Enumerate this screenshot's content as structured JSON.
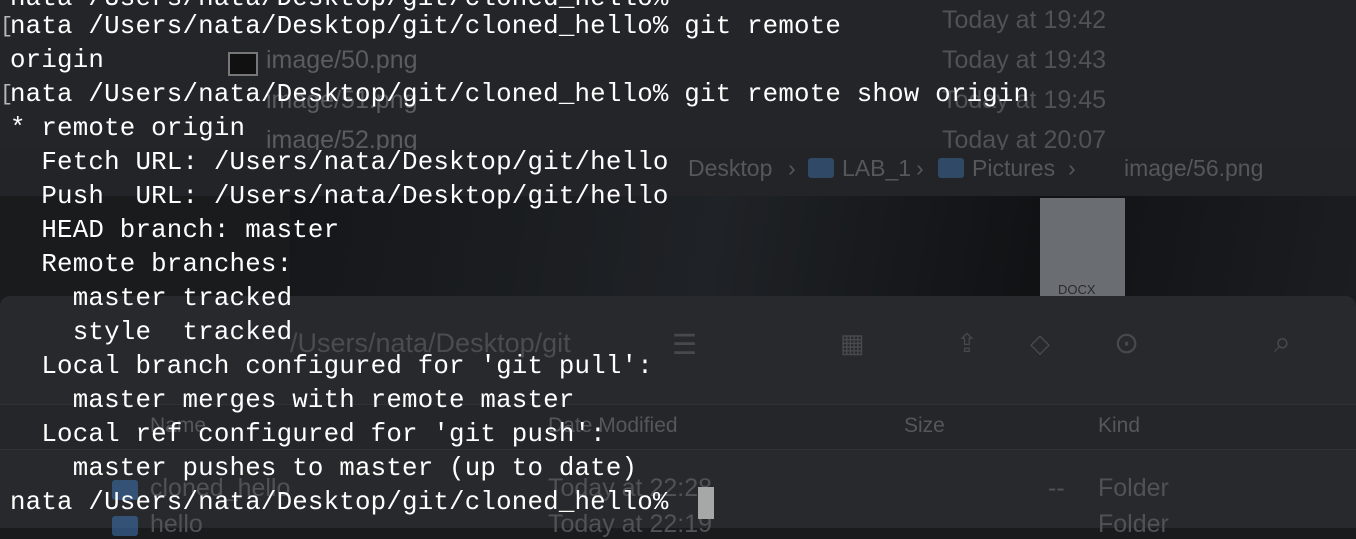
{
  "background_finder": {
    "file_rows": [
      {
        "name": "",
        "modified": "Today at 19:42"
      },
      {
        "name": "image/50.png",
        "modified": "Today at 19:43"
      },
      {
        "name": "image/51.png",
        "modified": "Today at 19:45"
      },
      {
        "name": "image/52.png",
        "modified": "Today at 20:07"
      }
    ],
    "path_bar": [
      "Desktop",
      "LAB_1",
      "Pictures",
      "image/56.png"
    ],
    "doc_thumb_label": "DOCX",
    "window2_title": "/Users/nata/Desktop/git",
    "columns": {
      "name": "Name",
      "modified": "Date Modified",
      "size": "Size",
      "kind": "Kind"
    },
    "rows": [
      {
        "name": "cloned_hello",
        "modified": "Today at 22:28",
        "size": "--",
        "kind": "Folder"
      },
      {
        "name": "hello",
        "modified": "Today at 22:19",
        "size": "--",
        "kind": "Folder"
      }
    ]
  },
  "terminal": {
    "top_partial_line": "nata /Users/nata/Desktop/git/cloned_hello%",
    "lines": [
      "nata /Users/nata/Desktop/git/cloned_hello% git remote",
      "origin",
      "nata /Users/nata/Desktop/git/cloned_hello% git remote show origin",
      "* remote origin",
      "  Fetch URL: /Users/nata/Desktop/git/hello",
      "  Push  URL: /Users/nata/Desktop/git/hello",
      "  HEAD branch: master",
      "  Remote branches:",
      "    master tracked",
      "    style  tracked",
      "  Local branch configured for 'git pull':",
      "    master merges with remote master",
      "  Local ref configured for 'git push':",
      "    master pushes to master (up to date)",
      "nata /Users/nata/Desktop/git/cloned_hello% "
    ]
  },
  "colors": {
    "terminal_text": "#ffffff",
    "cursor": "#a7a7a7",
    "folder_icon": "#3b6ea8"
  }
}
